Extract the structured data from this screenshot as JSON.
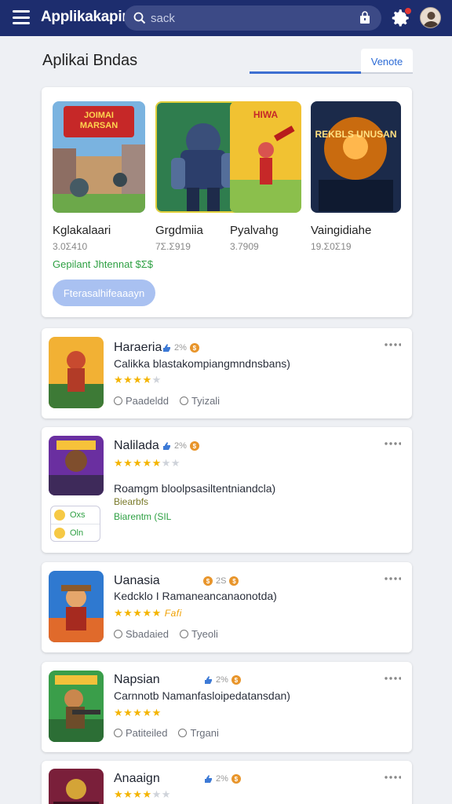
{
  "header": {
    "title": "Applikakapin",
    "search_placeholder": "sack",
    "icons": [
      "menu-icon",
      "search-icon",
      "bag-icon",
      "gear-icon",
      "avatar"
    ]
  },
  "section": {
    "title": "Aplikai Bndas",
    "see_more": "Venote"
  },
  "featured": {
    "items": [
      {
        "name": "Kglakalaari",
        "meta": "3.0Σ410",
        "banner": "JOIMAI MARSAN"
      },
      {
        "name": "Grgdmiia",
        "meta": "7Σ.Σ919",
        "banner": ""
      },
      {
        "name": "Pyalvahg",
        "meta": "3.7909",
        "banner": "HIWA"
      },
      {
        "name": "Vaingidiahe",
        "meta": "19.Σ0Σ19",
        "banner": "REKBLS UNUSAN"
      }
    ],
    "green_note": "Gepilant Jhtennat $Σ$",
    "install_label": "Fterasalhifeaaayn"
  },
  "apps": [
    {
      "name": "Haraeria",
      "badge": "2%",
      "desc": "Calikka blastakompiangmndnsbans)",
      "stars": 4,
      "half": false,
      "foot": [
        "Paadeldd",
        "Tyizali"
      ]
    },
    {
      "name": "Nalilada",
      "badge": "2%",
      "desc": "Roamgm bloolpsasiltentniandcla)",
      "stars": 5,
      "half": false,
      "extra_dim": 2,
      "green1": "Biearbfs",
      "green2": "Biarentm (SIL",
      "tags": [
        "Oxs",
        "Oln"
      ]
    },
    {
      "name": "Uanasia",
      "badge": "2S",
      "desc": "Kedcklo I Ramaneancanaonotda)",
      "stars": 5,
      "half": false,
      "extra": "Fafi",
      "foot": [
        "Sbadaied",
        "Tyeoli"
      ]
    },
    {
      "name": "Napsian",
      "badge": "2%",
      "desc": "Carnnotb Namanfasloipedatansdan)",
      "stars": 5,
      "half": false,
      "foot": [
        "Patiteiled",
        "Trgani"
      ]
    },
    {
      "name": "Anaaign",
      "badge": "2%",
      "stars": 4,
      "extra_dim": 1
    }
  ],
  "colors": {
    "topbar": "#1d2d6e",
    "accent": "#3d6fd1",
    "star": "#f4b400",
    "green": "#2ea043",
    "coin": "#e8952b"
  }
}
